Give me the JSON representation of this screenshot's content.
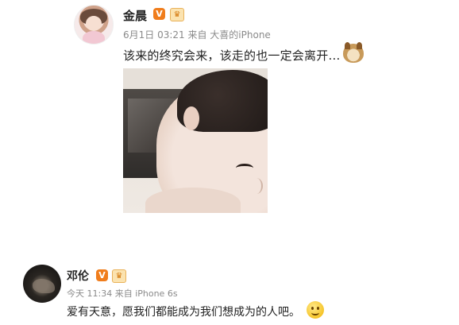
{
  "posts": [
    {
      "author": "金晨",
      "verified_badge": "V",
      "member_badge": "♛",
      "meta": "6月1日 03:21 来自 大喜的iPhone",
      "text": "该来的终究会来，该走的也一定会离开…",
      "emoji": "doge-emoji"
    },
    {
      "author": "邓伦",
      "verified_badge": "V",
      "member_badge": "♛",
      "meta": "今天 11:34 来自 iPhone 6s",
      "text": "爱有天意，愿我们都能成为我们想成为的人吧。",
      "emoji": "smile-emoji"
    }
  ],
  "colors": {
    "verified": "#f07d1c",
    "meta_text": "#8a8a8a",
    "body_text": "#222222"
  }
}
